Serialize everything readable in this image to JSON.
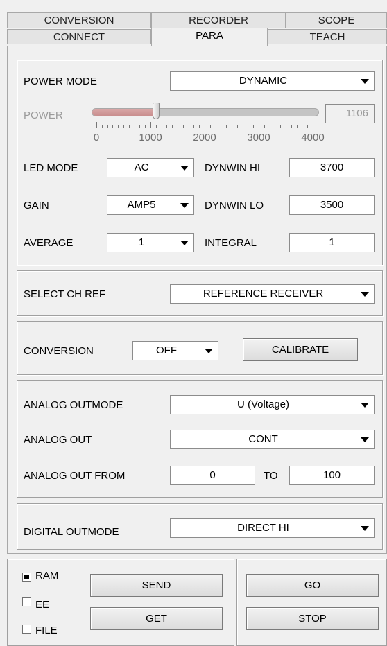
{
  "tabs_row1": [
    "CONVERSION",
    "RECORDER",
    "SCOPE"
  ],
  "tabs_row2": [
    "CONNECT",
    "PARA",
    "TEACH"
  ],
  "active_tab": "PARA",
  "power_mode": {
    "label": "POWER MODE",
    "value": "DYNAMIC"
  },
  "power": {
    "label": "POWER",
    "value": "1106",
    "min": 0,
    "max": 4000,
    "fraction": 0.2765,
    "tick_labels": [
      "0",
      "1000",
      "2000",
      "3000",
      "4000"
    ]
  },
  "led_mode": {
    "label": "LED MODE",
    "value": "AC"
  },
  "gain": {
    "label": "GAIN",
    "value": "AMP5"
  },
  "average": {
    "label": "AVERAGE",
    "value": "1"
  },
  "dynwin_hi": {
    "label": "DYNWIN HI",
    "value": "3700"
  },
  "dynwin_lo": {
    "label": "DYNWIN LO",
    "value": "3500"
  },
  "integral": {
    "label": "INTEGRAL",
    "value": "1"
  },
  "select_ch_ref": {
    "label": "SELECT CH REF",
    "value": "REFERENCE RECEIVER"
  },
  "conversion": {
    "label": "CONVERSION",
    "value": "OFF",
    "calibrate_label": "CALIBRATE"
  },
  "analog_outmode": {
    "label": "ANALOG OUTMODE",
    "value": "U (Voltage)"
  },
  "analog_out": {
    "label": "ANALOG OUT",
    "value": "CONT"
  },
  "analog_out_from": {
    "label": "ANALOG OUT FROM",
    "from": "0",
    "to_label": "TO",
    "to": "100"
  },
  "digital_outmode": {
    "label": "DIGITAL OUTMODE",
    "value": "DIRECT HI"
  },
  "memory": {
    "ram": {
      "label": "RAM",
      "checked": true
    },
    "ee": {
      "label": "EE",
      "checked": false
    },
    "file": {
      "label": "FILE",
      "checked": false
    }
  },
  "buttons": {
    "send": "SEND",
    "get": "GET",
    "go": "GO",
    "stop": "STOP"
  }
}
